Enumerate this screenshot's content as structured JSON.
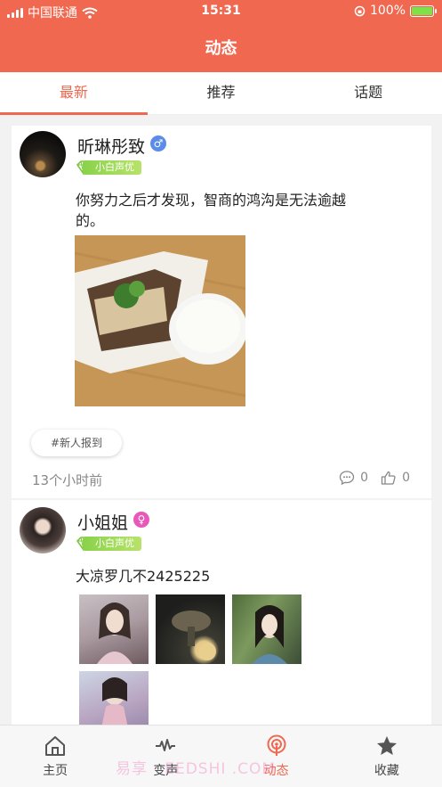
{
  "status_bar": {
    "carrier": "中国联通",
    "time": "15:31",
    "battery": "100%"
  },
  "header": {
    "title": "动态"
  },
  "tabs": [
    {
      "label": "最新",
      "active": true
    },
    {
      "label": "推荐",
      "active": false
    },
    {
      "label": "话题",
      "active": false
    }
  ],
  "posts": [
    {
      "user": "昕琳彤致",
      "gender": "male",
      "badge": "小白声优",
      "text": "你努力之后才发现，智商的鸿沟是无法逾越的。",
      "topic": "#新人报到",
      "time": "13个小时前",
      "comments": "0",
      "likes": "0"
    },
    {
      "user": "小姐姐",
      "gender": "female",
      "badge": "小白声优",
      "text": "大凉罗几不2425225",
      "image_count": 4
    }
  ],
  "bottom_nav": [
    {
      "label": "主页",
      "icon": "home-icon"
    },
    {
      "label": "变声",
      "icon": "waveform-icon"
    },
    {
      "label": "动态",
      "icon": "broadcast-icon",
      "active": true
    },
    {
      "label": "收藏",
      "icon": "star-icon"
    }
  ],
  "watermark": "易享 · EEDSHI .COM",
  "colors": {
    "accent": "#f0684f",
    "badge_green": "#8ad24a",
    "male": "#5b8de8",
    "female": "#e858b8"
  }
}
